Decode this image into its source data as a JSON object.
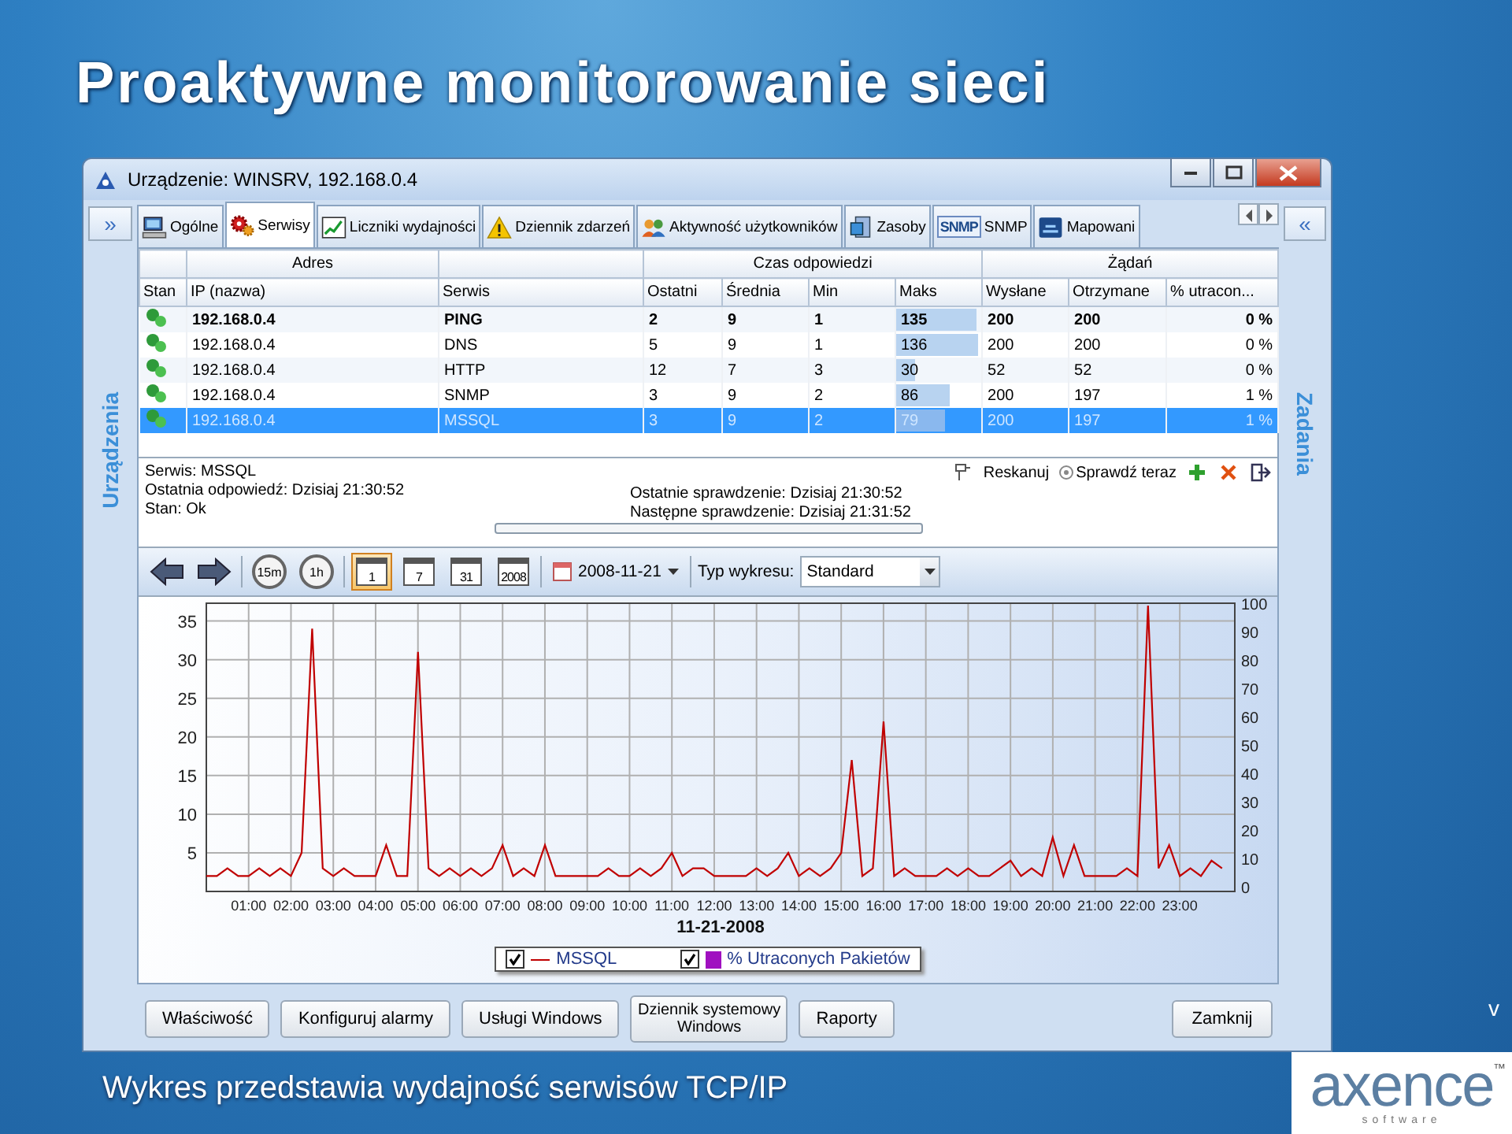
{
  "slide": {
    "title": "Proaktywne monitorowanie sieci",
    "caption": "Wykres przedstawia wydajność serwisów TCP/IP",
    "corner_mark": "v",
    "logo": {
      "name": "axence",
      "tagline": "software",
      "trademark": "™"
    }
  },
  "window": {
    "title": "Urządzenie: WINSRV, 192.168.0.4",
    "side_left": "Urządzenia",
    "side_right": "Zadania",
    "expand_left": "»",
    "expand_right": "«"
  },
  "tabs": [
    {
      "label": "Ogólne",
      "kind": "computer",
      "selected": false
    },
    {
      "label": "Serwisy",
      "kind": "gears",
      "selected": true
    },
    {
      "label": "Liczniki wydajności",
      "kind": "chart",
      "selected": false
    },
    {
      "label": "Dziennik zdarzeń",
      "kind": "warning",
      "selected": false
    },
    {
      "label": "Aktywność użytkowników",
      "kind": "users",
      "selected": false
    },
    {
      "label": "Zasoby",
      "kind": "server",
      "selected": false
    },
    {
      "label": "SNMP",
      "kind": "snmp",
      "icon_text": "SNMP",
      "selected": false
    },
    {
      "label": "Mapowani",
      "kind": "network",
      "selected": false
    }
  ],
  "table": {
    "groups": [
      {
        "columns": [
          "Stan"
        ]
      },
      {
        "label": "Adres",
        "columns": [
          "IP (nazwa)"
        ]
      },
      {
        "columns": [
          "Serwis"
        ]
      },
      {
        "label": "Czas odpowiedzi",
        "columns": [
          "Ostatni",
          "Średnia",
          "Min",
          "Maks"
        ]
      },
      {
        "label": "Żądań",
        "columns": [
          "Wysłane",
          "Otrzymane",
          "% utracon..."
        ]
      }
    ],
    "rows": [
      {
        "selected": false,
        "bold": true,
        "cells": [
          {
            "text": "192.168.0.4"
          },
          {
            "text": "PING"
          },
          {
            "text": "2"
          },
          {
            "text": "9"
          },
          {
            "text": "1"
          },
          {
            "text": "135",
            "level": 0.95
          },
          {
            "text": "200"
          },
          {
            "text": "200"
          },
          {
            "text": "0 %"
          }
        ]
      },
      {
        "selected": false,
        "bold": false,
        "cells": [
          {
            "text": "192.168.0.4"
          },
          {
            "text": "DNS"
          },
          {
            "text": "5"
          },
          {
            "text": "9"
          },
          {
            "text": "1"
          },
          {
            "text": "136",
            "level": 0.97
          },
          {
            "text": "200"
          },
          {
            "text": "200"
          },
          {
            "text": "0 %"
          }
        ]
      },
      {
        "selected": false,
        "bold": false,
        "cells": [
          {
            "text": "192.168.0.4"
          },
          {
            "text": "HTTP"
          },
          {
            "text": "12"
          },
          {
            "text": "7"
          },
          {
            "text": "3"
          },
          {
            "text": "30",
            "level": 0.22
          },
          {
            "text": "52"
          },
          {
            "text": "52"
          },
          {
            "text": "0 %"
          }
        ]
      },
      {
        "selected": false,
        "bold": false,
        "cells": [
          {
            "text": "192.168.0.4"
          },
          {
            "text": "SNMP"
          },
          {
            "text": "3"
          },
          {
            "text": "9"
          },
          {
            "text": "2"
          },
          {
            "text": "86",
            "level": 0.62
          },
          {
            "text": "200"
          },
          {
            "text": "197"
          },
          {
            "text": "1 %"
          }
        ]
      },
      {
        "selected": true,
        "bold": false,
        "cells": [
          {
            "text": "192.168.0.4"
          },
          {
            "text": "MSSQL"
          },
          {
            "text": "3"
          },
          {
            "text": "9"
          },
          {
            "text": "2"
          },
          {
            "text": "79",
            "level": 0.57
          },
          {
            "text": "200"
          },
          {
            "text": "197"
          },
          {
            "text": "1 %"
          }
        ]
      }
    ]
  },
  "details": {
    "left": [
      "Serwis: MSSQL",
      "Ostatnia odpowiedź: Dzisiaj 21:30:52",
      "Stan: Ok"
    ],
    "right": [
      "Ostatnie sprawdzenie: Dzisiaj 21:30:52",
      "Następne sprawdzenie: Dzisiaj 21:31:52"
    ],
    "actions": [
      {
        "kind": "pin"
      },
      {
        "kind": "link",
        "label": "Reskanuj"
      },
      {
        "kind": "check",
        "label": "Sprawdź teraz"
      },
      {
        "kind": "add"
      },
      {
        "kind": "delete"
      },
      {
        "kind": "export"
      }
    ]
  },
  "toolbar": {
    "buttons": [
      {
        "kind": "back",
        "selected": false
      },
      {
        "kind": "forward",
        "selected": false
      },
      {
        "kind": "clock",
        "label": "15m",
        "selected": false
      },
      {
        "kind": "clock",
        "label": "1h",
        "selected": false
      },
      {
        "kind": "calendar",
        "label": "1",
        "selected": true
      },
      {
        "kind": "calendar",
        "label": "7",
        "selected": false
      },
      {
        "kind": "calendar",
        "label": "31",
        "selected": false
      },
      {
        "kind": "calendar",
        "label": "2008",
        "selected": false
      }
    ],
    "date": "2008-11-21",
    "chart_type_label": "Typ wykresu:",
    "chart_type": "Standard"
  },
  "chart": {
    "chart_data": {
      "type": "line",
      "grid": true,
      "xlabel": "11-21-2008",
      "xlim": [
        0,
        24.3
      ],
      "ylim": [
        0,
        37.3
      ],
      "yticks": [
        5,
        10,
        15,
        20,
        25,
        30,
        35
      ],
      "xticks": [
        {
          "value": 1,
          "label": "01:00"
        },
        {
          "value": 2,
          "label": "02:00"
        },
        {
          "value": 3,
          "label": "03:00"
        },
        {
          "value": 4,
          "label": "04:00"
        },
        {
          "value": 5,
          "label": "05:00"
        },
        {
          "value": 6,
          "label": "06:00"
        },
        {
          "value": 7,
          "label": "07:00"
        },
        {
          "value": 8,
          "label": "08:00"
        },
        {
          "value": 9,
          "label": "09:00"
        },
        {
          "value": 10,
          "label": "10:00"
        },
        {
          "value": 11,
          "label": "11:00"
        },
        {
          "value": 12,
          "label": "12:00"
        },
        {
          "value": 13,
          "label": "13:00"
        },
        {
          "value": 14,
          "label": "14:00"
        },
        {
          "value": 15,
          "label": "15:00"
        },
        {
          "value": 16,
          "label": "16:00"
        },
        {
          "value": 17,
          "label": "17:00"
        },
        {
          "value": 18,
          "label": "18:00"
        },
        {
          "value": 19,
          "label": "19:00"
        },
        {
          "value": 20,
          "label": "20:00"
        },
        {
          "value": 21,
          "label": "21:00"
        },
        {
          "value": 22,
          "label": "22:00"
        },
        {
          "value": 23,
          "label": "23:00"
        }
      ],
      "x": [
        0,
        0.25,
        0.5,
        0.75,
        1,
        1.25,
        1.5,
        1.75,
        2,
        2.25,
        2.5,
        2.75,
        3,
        3.25,
        3.5,
        3.75,
        4,
        4.25,
        4.5,
        4.75,
        5,
        5.25,
        5.5,
        5.75,
        6,
        6.25,
        6.5,
        6.75,
        7,
        7.25,
        7.5,
        7.75,
        8,
        8.25,
        8.5,
        8.75,
        9,
        9.25,
        9.5,
        9.75,
        10,
        10.25,
        10.5,
        10.75,
        11,
        11.25,
        11.5,
        11.75,
        12,
        12.25,
        12.5,
        12.75,
        13,
        13.25,
        13.5,
        13.75,
        14,
        14.25,
        14.5,
        14.75,
        15,
        15.25,
        15.5,
        15.75,
        16,
        16.25,
        16.5,
        16.75,
        17,
        17.25,
        17.5,
        17.75,
        18,
        18.25,
        18.5,
        18.75,
        19,
        19.25,
        19.5,
        19.75,
        20,
        20.25,
        20.5,
        20.75,
        21,
        21.25,
        21.5,
        21.75,
        22,
        22.25,
        22.5,
        22.75,
        23,
        23.25,
        23.5,
        23.75,
        24
      ],
      "series": [
        {
          "name": "MSSQL",
          "color": "#c00000",
          "values": [
            2,
            2,
            3,
            2,
            2,
            3,
            2,
            3,
            2,
            5,
            34,
            3,
            2,
            3,
            2,
            2,
            2,
            6,
            2,
            2,
            31,
            3,
            2,
            3,
            2,
            3,
            2,
            3,
            6,
            2,
            3,
            2,
            6,
            2,
            2,
            2,
            2,
            2,
            3,
            2,
            2,
            3,
            2,
            3,
            5,
            2,
            3,
            3,
            2,
            2,
            2,
            2,
            3,
            2,
            3,
            5,
            2,
            3,
            2,
            3,
            5,
            17,
            2,
            3,
            22,
            2,
            3,
            2,
            2,
            2,
            3,
            2,
            3,
            2,
            2,
            3,
            4,
            2,
            3,
            2,
            7,
            2,
            6,
            2,
            2,
            2,
            2,
            3,
            2,
            37,
            3,
            6,
            2,
            3,
            2,
            4,
            3
          ]
        }
      ]
    },
    "right_axis_labels": [
      "100",
      "90",
      "80",
      "70",
      "60",
      "50",
      "40",
      "30",
      "20",
      "10",
      "0"
    ],
    "legend": [
      {
        "kind": "line",
        "checked": true,
        "color": "#c00000"
      },
      {
        "label": "% Utraconych Pakietów",
        "kind": "swatch",
        "checked": true,
        "color": "#a010c0"
      }
    ]
  },
  "buttons": [
    "Właściwość",
    "Konfiguruj alarmy",
    "Usługi Windows",
    "Dziennik systemowy Windows",
    "Raporty"
  ],
  "close_button": "Zamknij"
}
